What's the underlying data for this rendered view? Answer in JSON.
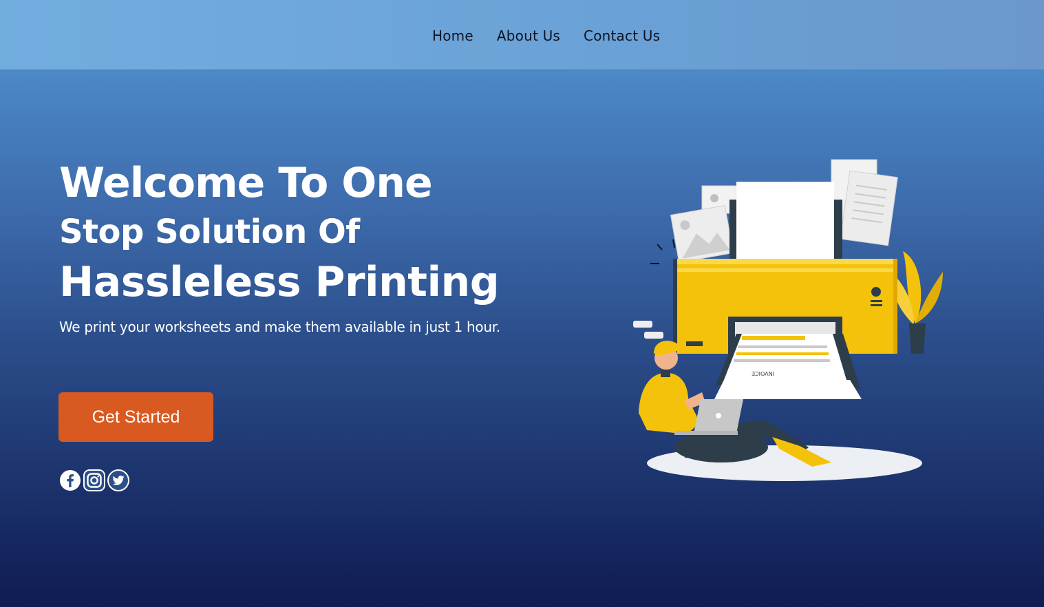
{
  "nav": {
    "links": [
      "Home",
      "About Us",
      "Contact Us"
    ]
  },
  "hero": {
    "title_line1": "Welcome To One",
    "title_line2": "Stop Solution Of",
    "title_line3": "Hassleless Printing",
    "subtitle": "We print your worksheets and make them available in just 1 hour.",
    "cta_label": "Get Started"
  },
  "illustration": {
    "invoice_text": "INVOICE"
  },
  "socials": [
    "facebook-icon",
    "instagram-icon",
    "twitter-icon"
  ],
  "colors": {
    "accent": "#d85a21",
    "printer_yellow": "#f5c20b",
    "dark_teal": "#2d3e4a"
  }
}
